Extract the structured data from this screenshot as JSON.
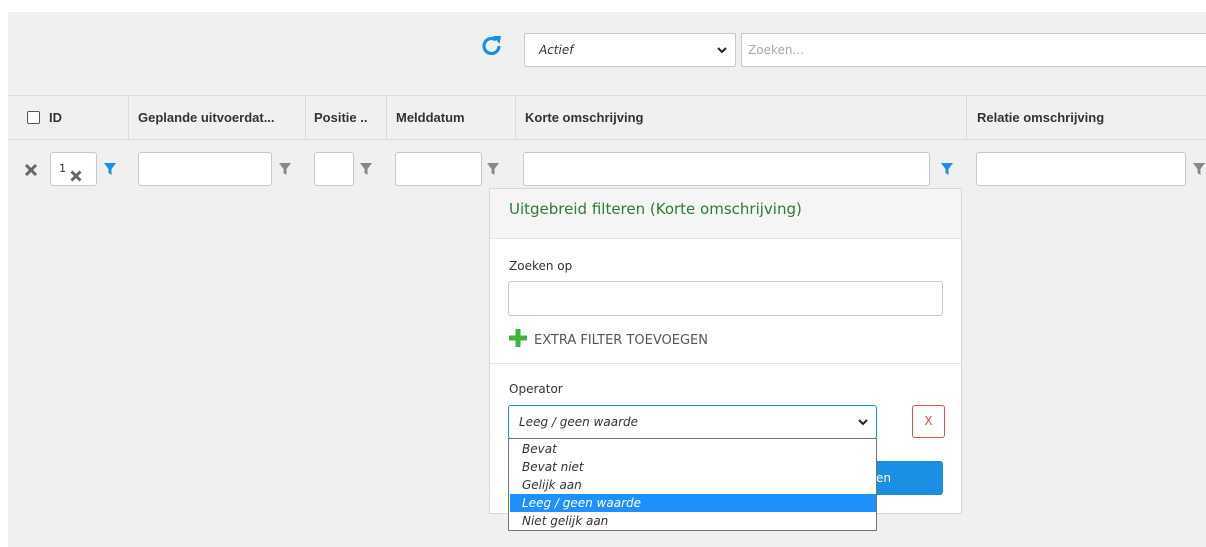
{
  "toolbar": {
    "status_value": "Actief",
    "search_placeholder": "Zoeken..."
  },
  "table": {
    "columns": [
      "ID",
      "Geplande uitvoerdat...",
      "Positie ..",
      "Melddatum",
      "Korte omschrijving",
      "Relatie omschrijving"
    ],
    "id_filter_value": "1"
  },
  "popup": {
    "title": "Uitgebreid filteren (Korte omschrijving)",
    "search_label": "Zoeken op",
    "add_filter_label": "EXTRA FILTER TOEVOEGEN",
    "operator_label": "Operator",
    "operator_value": "Leeg / geen waarde",
    "remove_label": "X",
    "apply_label_partial": "en",
    "operator_options": [
      "Bevat",
      "Bevat niet",
      "Gelijk aan",
      "Leeg / geen waarde",
      "Niet gelijk aan"
    ],
    "selected_index": 3
  },
  "colors": {
    "accent": "#1a8fe3",
    "title_green": "#2e7d32",
    "add_green": "#3cb53c",
    "remove_red": "#d9534f",
    "selected_option": "#1e90ff"
  },
  "icons": [
    "refresh-icon",
    "chevron-down-icon",
    "close-icon",
    "filter-icon",
    "plus-icon"
  ]
}
